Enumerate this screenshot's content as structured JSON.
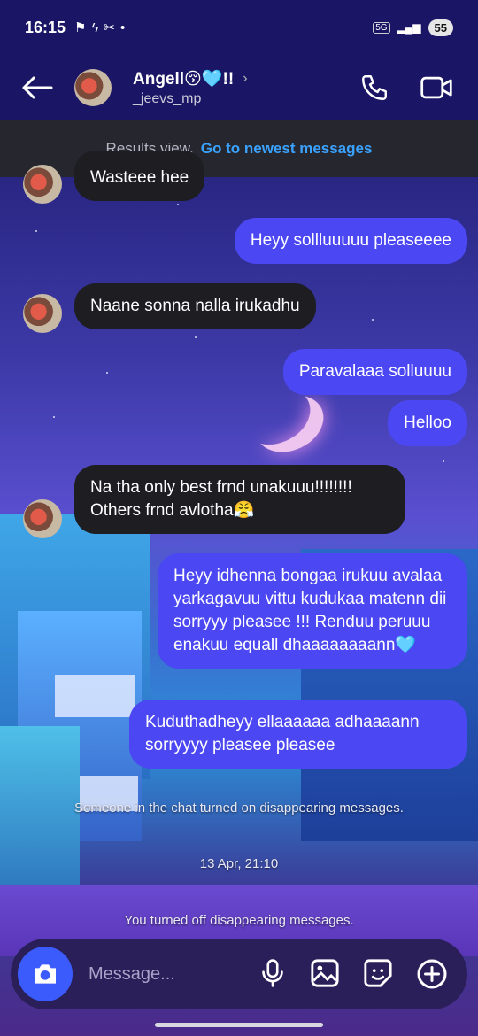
{
  "status_bar": {
    "time": "16:15",
    "network": "5G",
    "battery": "55"
  },
  "header": {
    "name": "Angell😚🩵!!",
    "username": "_jeevs_mp"
  },
  "banner": {
    "text": "Results view.",
    "link": "Go to newest messages"
  },
  "messages": [
    {
      "from": "them",
      "text": "Wasteee hee"
    },
    {
      "from": "me",
      "text": "Heyy sollluuuuu pleaseeee"
    },
    {
      "from": "them",
      "text": "Naane sonna nalla irukadhu"
    },
    {
      "from": "me",
      "text": "Paravalaaa solluuuu"
    },
    {
      "from": "me",
      "text": "Helloo"
    },
    {
      "from": "them",
      "text": "Na tha only best frnd unakuuu!!!!!!!! Others frnd avlotha😤"
    },
    {
      "from": "me",
      "text": "Heyy idhenna bongaa irukuu avalaa yarkagavuu vittu kudukaa matenn dii sorryyy pleasee !!! Renduu peruuu enakuu equall dhaaaaaaaann🩵"
    },
    {
      "from": "me",
      "text": "Kuduthadheyy ellaaaaaa adhaaaann sorryyyy pleasee pleasee"
    }
  ],
  "system": {
    "disappearing_on": "Someone in the chat turned on disappearing messages.",
    "timestamp": "13 Apr, 21:10",
    "disappearing_off": "You turned off disappearing messages."
  },
  "composer": {
    "placeholder": "Message..."
  },
  "colors": {
    "outgoing_bubble": "#4b47f2",
    "incoming_bubble": "#1d1d22",
    "link": "#3aa2ff"
  }
}
